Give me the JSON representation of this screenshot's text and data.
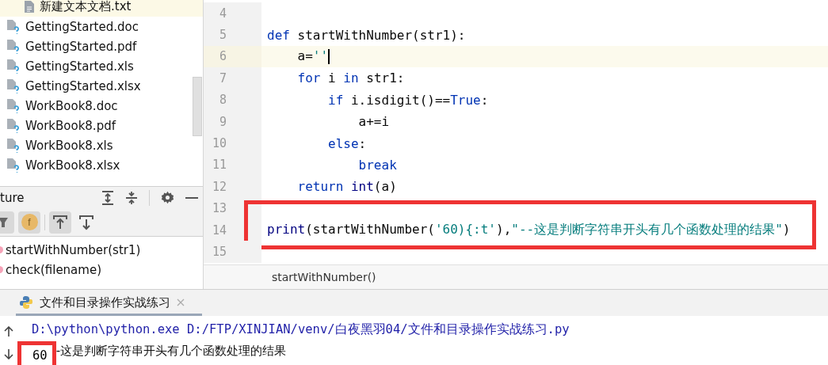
{
  "project_tree": {
    "items": [
      {
        "name": "新建文本文档.txt",
        "kind": "text",
        "selected": true
      },
      {
        "name": "GettingStarted.doc",
        "kind": "unknown",
        "selected": false
      },
      {
        "name": "GettingStarted.pdf",
        "kind": "unknown",
        "selected": false
      },
      {
        "name": "GettingStarted.xls",
        "kind": "unknown",
        "selected": false
      },
      {
        "name": "GettingStarted.xlsx",
        "kind": "unknown",
        "selected": false
      },
      {
        "name": "WorkBook8.doc",
        "kind": "unknown",
        "selected": false
      },
      {
        "name": "WorkBook8.pdf",
        "kind": "unknown",
        "selected": false
      },
      {
        "name": "WorkBook8.xls",
        "kind": "unknown",
        "selected": false
      },
      {
        "name": "WorkBook8.xlsx",
        "kind": "unknown",
        "selected": false
      }
    ]
  },
  "structure": {
    "title": "ture",
    "toolbar": [
      {
        "kind": "inherited",
        "selected": true
      },
      {
        "kind": "fields",
        "selected": true,
        "label": "f"
      },
      {
        "kind": "autoscroll-to",
        "selected": true
      },
      {
        "kind": "autoscroll-from",
        "selected": false
      }
    ],
    "items": [
      "startWithNumber(str1)",
      "check(filename)"
    ]
  },
  "editor": {
    "lines": [
      {
        "number": "4",
        "current": false,
        "highlighted": false
      },
      {
        "number": "5",
        "current": false,
        "highlighted": false,
        "tokens": [
          {
            "text": "def",
            "kind": "keyword"
          },
          {
            "text": " startWithNumber(str1):",
            "kind": "plain"
          }
        ]
      },
      {
        "number": "6",
        "current": true,
        "highlighted": false,
        "tokens": [
          {
            "text": "    a=",
            "kind": "plain"
          },
          {
            "text": "''",
            "kind": "string"
          }
        ]
      },
      {
        "number": "7",
        "current": false,
        "highlighted": false,
        "tokens": [
          {
            "text": "    for",
            "kind": "keyword"
          },
          {
            "text": " i ",
            "kind": "plain"
          },
          {
            "text": "in",
            "kind": "keyword"
          },
          {
            "text": " str1:",
            "kind": "plain"
          }
        ]
      },
      {
        "number": "8",
        "current": false,
        "highlighted": false,
        "tokens": [
          {
            "text": "        if",
            "kind": "keyword"
          },
          {
            "text": " i.isdigit()==",
            "kind": "plain"
          },
          {
            "text": "True",
            "kind": "keyword"
          },
          {
            "text": ":",
            "kind": "plain"
          }
        ]
      },
      {
        "number": "9",
        "current": false,
        "highlighted": false,
        "tokens": [
          {
            "text": "            a+=i",
            "kind": "plain"
          }
        ]
      },
      {
        "number": "10",
        "current": false,
        "highlighted": false,
        "tokens": [
          {
            "text": "        else",
            "kind": "keyword"
          },
          {
            "text": ":",
            "kind": "plain"
          }
        ]
      },
      {
        "number": "11",
        "current": false,
        "highlighted": false,
        "tokens": [
          {
            "text": "            break",
            "kind": "keyword"
          }
        ]
      },
      {
        "number": "12",
        "current": false,
        "highlighted": false,
        "tokens": [
          {
            "text": "    return",
            "kind": "keyword"
          },
          {
            "text": " int",
            "kind": "builtin"
          },
          {
            "text": "(a)",
            "kind": "plain"
          }
        ]
      },
      {
        "number": "13",
        "current": false,
        "highlighted": false
      },
      {
        "number": "14",
        "current": false,
        "highlighted": true,
        "tokens": [
          {
            "text": "print",
            "kind": "builtin"
          },
          {
            "text": "(startWithNumber(",
            "kind": "plain"
          },
          {
            "text": "'60){:t'",
            "kind": "string"
          },
          {
            "text": "),",
            "kind": "plain"
          },
          {
            "text": "\"--这是判断字符串开头有几个函数处理的结果\"",
            "kind": "string"
          },
          {
            "text": ")",
            "kind": "plain"
          }
        ]
      },
      {
        "number": "15",
        "current": false,
        "highlighted": false
      }
    ],
    "breadcrumb": "startWithNumber()"
  },
  "run": {
    "tab": "文件和目录操作实战练习",
    "command": "D:\\python\\python.exe D:/FTP/XINJIAN/venv/白夜黑羽04/文件和目录操作实战练习.py",
    "output_value": "60",
    "output_value_highlighted": true,
    "output_text": "-这是判断字符串开头有几个函数处理的结果"
  }
}
